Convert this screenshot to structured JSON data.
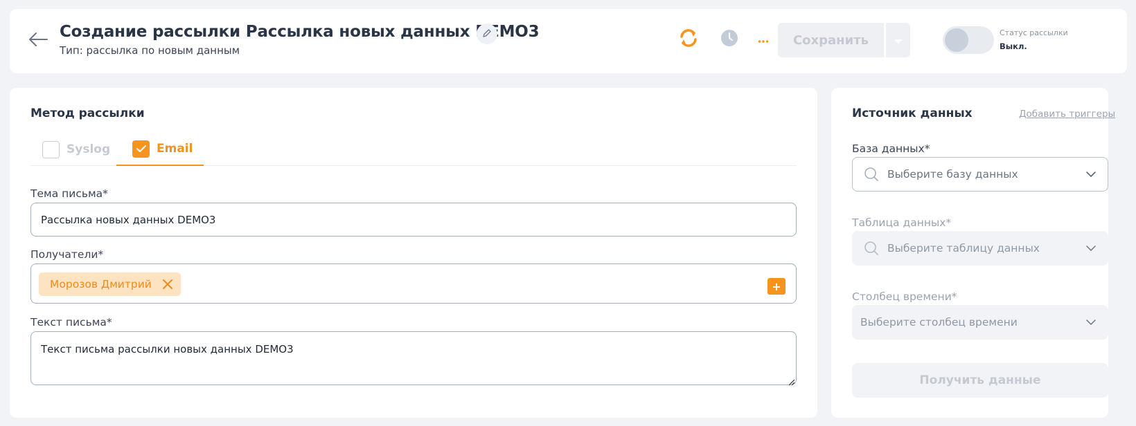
{
  "header": {
    "title": "Создание рассылки Рассылка новых данных DEMO3",
    "subtitle": "Тип: рассылка по новым данным",
    "save_label": "Сохранить",
    "status_label": "Статус рассылки",
    "status_value": "Выкл.",
    "toggle_on": false,
    "accent_color": "#f7941d"
  },
  "method": {
    "title": "Метод рассылки",
    "tabs": [
      {
        "label": "Syslog",
        "checked": false
      },
      {
        "label": "Email",
        "checked": true
      }
    ]
  },
  "form": {
    "subject_label": "Тема письма*",
    "subject_value": "Рассылка новых данных DEMO3",
    "recipients_label": "Получатели*",
    "recipients": [
      "Морозов Дмитрий"
    ],
    "add_symbol": "+",
    "body_label": "Текст письма*",
    "body_value": "Текст письма рассылки новых данных DEMO3"
  },
  "datasource": {
    "title": "Источник данных",
    "add_triggers": "Добавить триггеры",
    "db_label": "База данных*",
    "db_placeholder": "Выберите базу данных",
    "table_label": "Таблица данных*",
    "table_placeholder": "Выберите таблицу данных",
    "time_label": "Столбец времени*",
    "time_placeholder": "Выберите столбец времени",
    "get_button": "Получить данные"
  }
}
